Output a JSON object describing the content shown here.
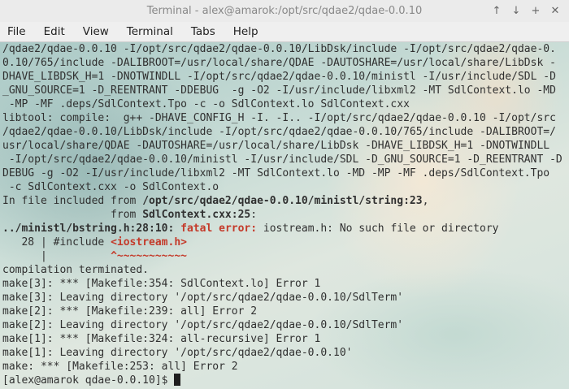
{
  "window": {
    "title": "Terminal - alex@amarok:/opt/src/qdae2/qdae-0.0.10",
    "buttons": [
      "↑",
      "↓",
      "+",
      "✕"
    ]
  },
  "menu": [
    "File",
    "Edit",
    "View",
    "Terminal",
    "Tabs",
    "Help"
  ],
  "colors": {
    "error_red": "#c43a2a",
    "text": "#303030"
  },
  "terminal": {
    "lines": [
      [
        {
          "t": "/qdae2/qdae-0.0.10 -I/opt/src/qdae2/qdae-0.0.10/LibDsk/include -I/opt/src/qdae2/qdae-0."
        }
      ],
      [
        {
          "t": "0.10/765/include -DALIBROOT=/usr/local/share/QDAE -DAUTOSHARE=/usr/local/share/LibDsk -"
        }
      ],
      [
        {
          "t": "DHAVE_LIBDSK_H=1 -DNOTWINDLL -I/opt/src/qdae2/qdae-0.0.10/ministl -I/usr/include/SDL -D"
        }
      ],
      [
        {
          "t": "_GNU_SOURCE=1 -D_REENTRANT -DDEBUG  -g -O2 -I/usr/include/libxml2 -MT SdlContext.lo -MD"
        }
      ],
      [
        {
          "t": " -MP -MF .deps/SdlContext.Tpo -c -o SdlContext.lo SdlContext.cxx"
        }
      ],
      [
        {
          "t": "libtool: compile:  g++ -DHAVE_CONFIG_H -I. -I.. -I/opt/src/qdae2/qdae-0.0.10 -I/opt/src"
        }
      ],
      [
        {
          "t": "/qdae2/qdae-0.0.10/LibDsk/include -I/opt/src/qdae2/qdae-0.0.10/765/include -DALIBROOT=/"
        }
      ],
      [
        {
          "t": "usr/local/share/QDAE -DAUTOSHARE=/usr/local/share/LibDsk -DHAVE_LIBDSK_H=1 -DNOTWINDLL"
        }
      ],
      [
        {
          "t": " -I/opt/src/qdae2/qdae-0.0.10/ministl -I/usr/include/SDL -D_GNU_SOURCE=1 -D_REENTRANT -D"
        }
      ],
      [
        {
          "t": "DEBUG -g -O2 -I/usr/include/libxml2 -MT SdlContext.lo -MD -MP -MF .deps/SdlContext.Tpo"
        }
      ],
      [
        {
          "t": " -c SdlContext.cxx -o SdlContext.o"
        }
      ],
      [
        {
          "t": "In file included from "
        },
        {
          "t": "/opt/src/qdae2/qdae-0.0.10/ministl/string:23",
          "s": "b"
        },
        {
          "t": ","
        }
      ],
      [
        {
          "t": "                 from "
        },
        {
          "t": "SdlContext.cxx:25",
          "s": "b"
        },
        {
          "t": ":"
        }
      ],
      [
        {
          "t": "../ministl/bstring.h:28:10: ",
          "s": "b"
        },
        {
          "t": "fatal error: ",
          "s": "red"
        },
        {
          "t": "iostream.h: No such file or directory"
        }
      ],
      [
        {
          "t": "   28 | #include "
        },
        {
          "t": "<iostream.h>",
          "s": "red"
        }
      ],
      [
        {
          "t": "      |          "
        },
        {
          "t": "^~~~~~~~~~~~",
          "s": "red"
        }
      ],
      [
        {
          "t": "compilation terminated."
        }
      ],
      [
        {
          "t": "make[3]: *** [Makefile:354: SdlContext.lo] Error 1"
        }
      ],
      [
        {
          "t": "make[3]: Leaving directory '/opt/src/qdae2/qdae-0.0.10/SdlTerm'"
        }
      ],
      [
        {
          "t": "make[2]: *** [Makefile:239: all] Error 2"
        }
      ],
      [
        {
          "t": "make[2]: Leaving directory '/opt/src/qdae2/qdae-0.0.10/SdlTerm'"
        }
      ],
      [
        {
          "t": "make[1]: *** [Makefile:324: all-recursive] Error 1"
        }
      ],
      [
        {
          "t": "make[1]: Leaving directory '/opt/src/qdae2/qdae-0.0.10'"
        }
      ],
      [
        {
          "t": "make: *** [Makefile:253: all] Error 2"
        }
      ],
      [
        {
          "t": "[alex@amarok qdae-0.0.10]$ "
        }
      ]
    ]
  }
}
